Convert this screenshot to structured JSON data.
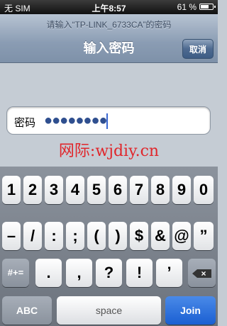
{
  "status_bar": {
    "carrier": "无 SIM",
    "time": "上午8:57",
    "battery": "61 %"
  },
  "nav": {
    "prompt": "请输入“TP-LINK_6733CA”的密码",
    "title": "输入密码",
    "cancel": "取消"
  },
  "password_field": {
    "label": "密码",
    "value_masked": "●●●●●●●●"
  },
  "watermark": "网际:wjdiy.cn",
  "keyboard": {
    "row1": [
      "1",
      "2",
      "3",
      "4",
      "5",
      "6",
      "7",
      "8",
      "9",
      "0"
    ],
    "row2": [
      "–",
      "/",
      ":",
      ";",
      "(",
      ")",
      "$",
      "&",
      "@",
      "”"
    ],
    "row3": [
      ".",
      ",",
      "?",
      "!",
      "’"
    ],
    "mode_key": "#+=",
    "backspace_icon": "backspace-icon",
    "abc": "ABC",
    "space": "space",
    "join": "Join"
  },
  "colors": {
    "join_blue": "#2b6fdb",
    "watermark_red": "#e0262b",
    "caret_blue": "#3a67d2"
  }
}
